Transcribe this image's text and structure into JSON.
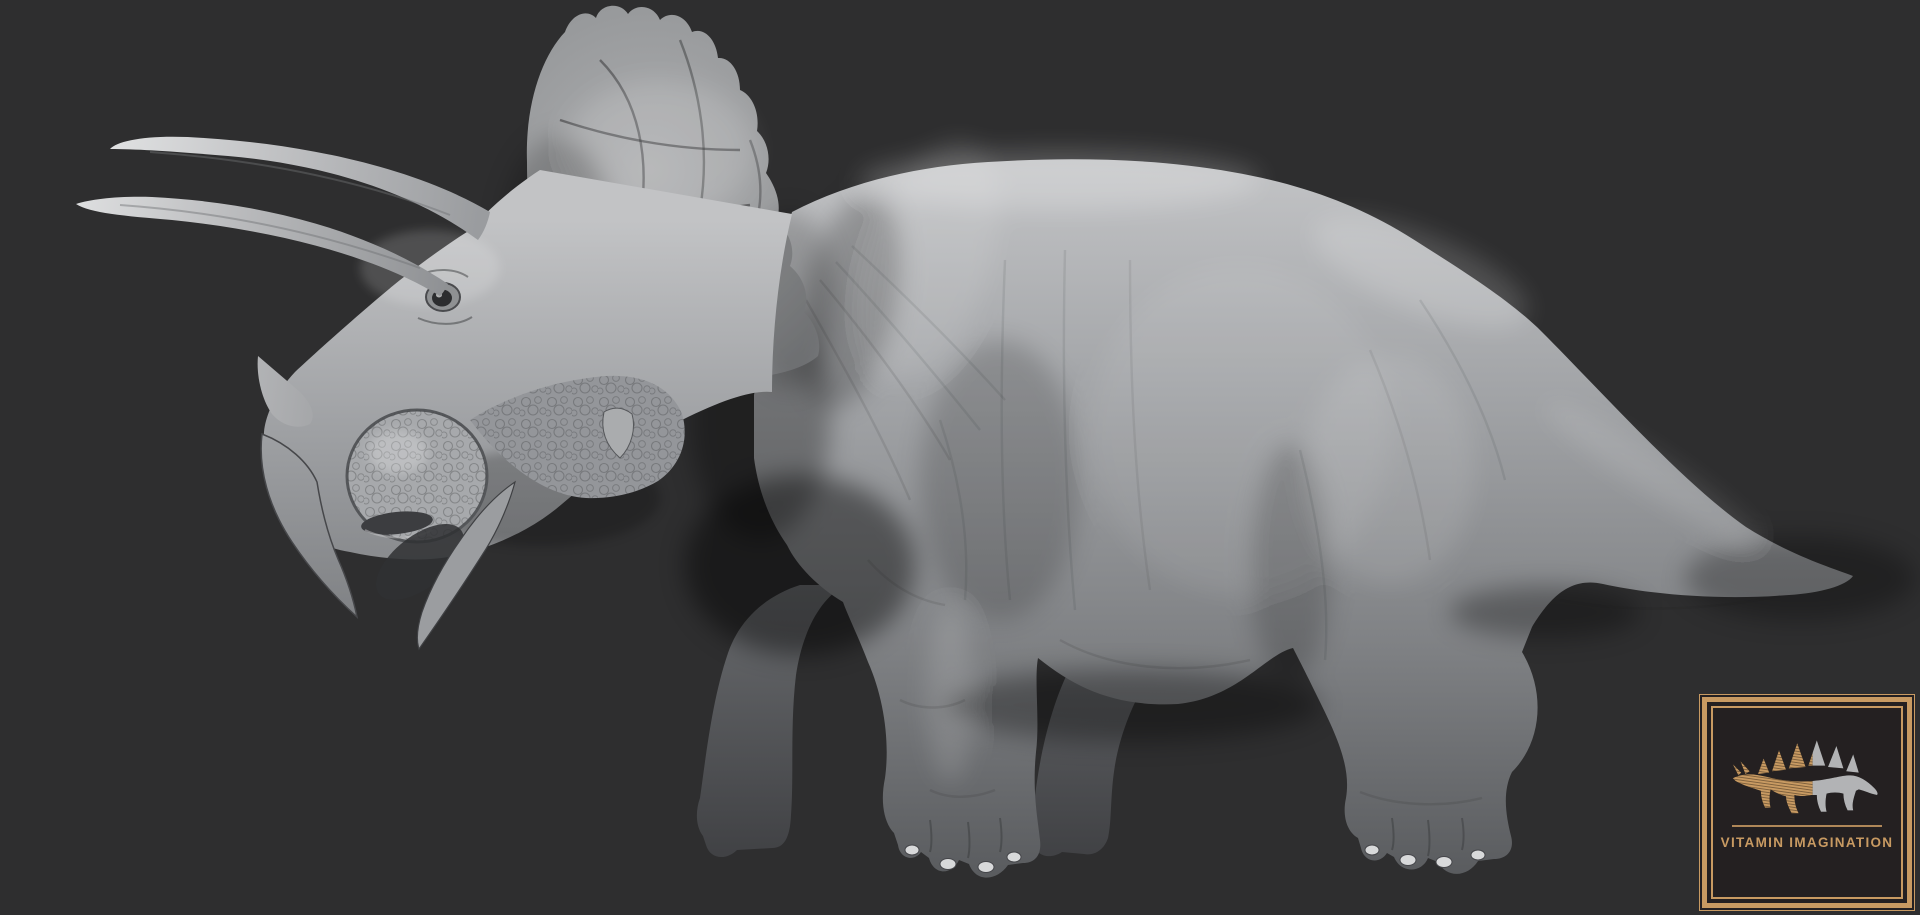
{
  "theme": {
    "bg": "#2e2e2f",
    "gold": "#c89a62",
    "gold-bright": "#dcb37c",
    "panel-bg": "#242021",
    "logo-gray": "#b2b3b5"
  },
  "scene": {
    "subject": "triceratops-clay-sculpt",
    "facing": "left",
    "clay_mid_color": "#9b9da0",
    "clay_highlight_color": "#d8d9da",
    "clay_shadow_color": "#4a4c4f"
  },
  "logo_badge": {
    "icon": "stegosaurus-icon",
    "brand_text": "VITAMIN IMAGINATION"
  }
}
